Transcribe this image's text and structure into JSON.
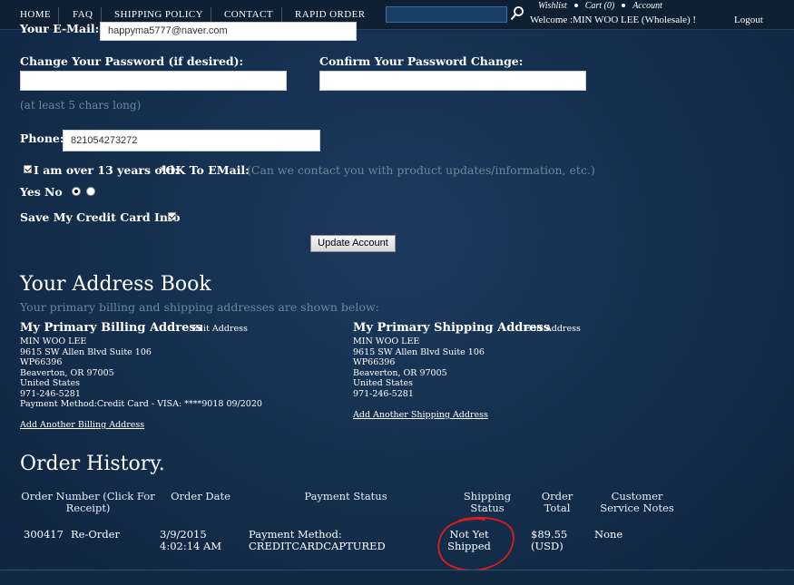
{
  "nav": {
    "items": [
      "HOME",
      "FAQ",
      "SHIPPING POLICY",
      "CONTACT",
      "RAPID ORDER"
    ],
    "wishlist": "Wishlist",
    "cart": "Cart (0)",
    "account": "Account",
    "welcome": "Welcome :MIN WOO LEE (Wholesale) !",
    "logout": "Logout"
  },
  "form": {
    "email_label": "Your E-Mail:",
    "email_value": "happyma5777@naver.com",
    "password_label": "Change Your Password (if desired):",
    "confirm_label": "Confirm Your Password Change:",
    "password_hint": "(at least 5 chars long)",
    "phone_label": "Phone:",
    "phone_value": "821054273272",
    "age_label": "I am over 13 years old:",
    "ok_email_label": "*OK To EMail:",
    "ok_email_hint": "(Can we contact you with product updates/information, etc.)",
    "yes_label": "Yes",
    "no_label": "No",
    "save_card_label": "Save My Credit Card Info",
    "update_button": "Update Account"
  },
  "address_book": {
    "title": "Your Address Book",
    "subtitle": "Your primary billing and shipping addresses are shown below:",
    "billing": {
      "heading": "My Primary Billing Address",
      "edit": "Edit Address",
      "lines": [
        "MIN WOO LEE",
        "9615 SW Allen Blvd Suite 106",
        "WP66396",
        "Beaverton, OR 97005",
        "United States",
        "971-246-5281",
        "Payment Method:Credit Card - VISA: ****9018 09/2020"
      ],
      "add": "Add Another Billing Address"
    },
    "shipping": {
      "heading": "My Primary Shipping Address",
      "edit": "Edit Address",
      "lines": [
        "MIN WOO LEE",
        "9615 SW Allen Blvd Suite 106",
        "WP66396",
        "Beaverton, OR 97005",
        "United States",
        "971-246-5281"
      ],
      "add": "Add Another Shipping Address"
    }
  },
  "order_history": {
    "title": "Order History.",
    "headers": {
      "order_number": "Order Number (Click For Receipt)",
      "order_date": "Order Date",
      "payment_status": "Payment Status",
      "shipping_status": "Shipping Status",
      "order_total": "Order Total",
      "notes": "Customer Service Notes"
    },
    "rows": [
      {
        "order_number": "300417",
        "reorder": "Re-Order",
        "date": "3/9/2015 4:02:14 AM",
        "payment": "Payment Method: CREDITCARDCAPTURED",
        "shipping": "Not Yet Shipped",
        "total": "$89.55 (USD)",
        "notes": "None"
      }
    ]
  },
  "colors": {
    "background": "#15304f",
    "topbar": "#0f2035",
    "hint": "#6f859e",
    "annotation": "#e01b1b"
  }
}
